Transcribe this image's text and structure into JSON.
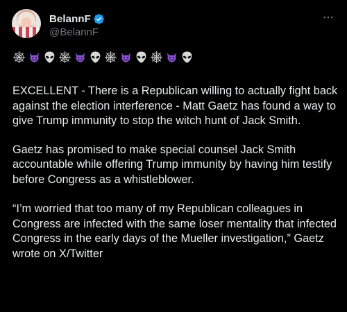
{
  "author": {
    "display_name": "BelannF",
    "handle": "@BelannF",
    "verified_badge_color": "#1d9bf0"
  },
  "menu": {
    "more_icon": "more-horizontal-icon"
  },
  "emoji_sequence": [
    "spider-web",
    "smiling-imp",
    "alien",
    "spider-web",
    "smiling-imp",
    "alien",
    "spider-web",
    "smiling-imp",
    "alien",
    "spider-web",
    "smiling-imp",
    "alien"
  ],
  "paragraphs": [
    "EXCELLENT - There is a Republican willing to actually fight back against the election interference - Matt Gaetz has found a way to give Trump immunity to stop the witch hunt of Jack Smith.",
    "Gaetz has promised to make special counsel Jack Smith accountable while offering Trump immunity by having him testify before Congress as a whistleblower.",
    "“I’m worried that too many of my Republican colleagues in Congress are infected with the same loser mentality that infected Congress in the early days of the Mueller investigation,” Gaetz wrote on X/Twitter"
  ],
  "colors": {
    "background": "#000000",
    "text": "#e7e9ea",
    "secondary_text": "#71767b",
    "imp_purple": "#8a4fd1"
  }
}
